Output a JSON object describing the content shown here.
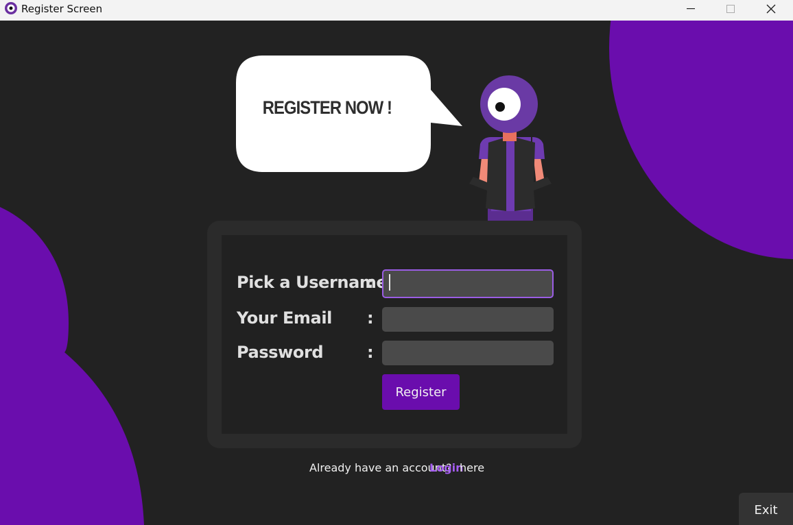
{
  "window": {
    "title": "Register Screen",
    "controls": [
      "minimize",
      "maximize",
      "close"
    ]
  },
  "hero": {
    "speech_bubble_text": "REGISTER NOW !",
    "mascot": "one-eyed-purple-character"
  },
  "form": {
    "fields": [
      {
        "label": "Pick a Username",
        "colon": ":",
        "value": "",
        "focused": true
      },
      {
        "label": "Your Email",
        "colon": ":",
        "value": ""
      },
      {
        "label": "Password",
        "colon": ":",
        "value": ""
      }
    ],
    "register_label": "Register"
  },
  "login": {
    "prefix": "Already have an account?",
    "link": "Login",
    "suffix": "here"
  },
  "exit_label": "Exit",
  "colors": {
    "background": "#222222",
    "accent": "#6a0dad",
    "link": "#a45cf0",
    "input": "#4a4a4a",
    "focus_border": "#9b5de5"
  }
}
